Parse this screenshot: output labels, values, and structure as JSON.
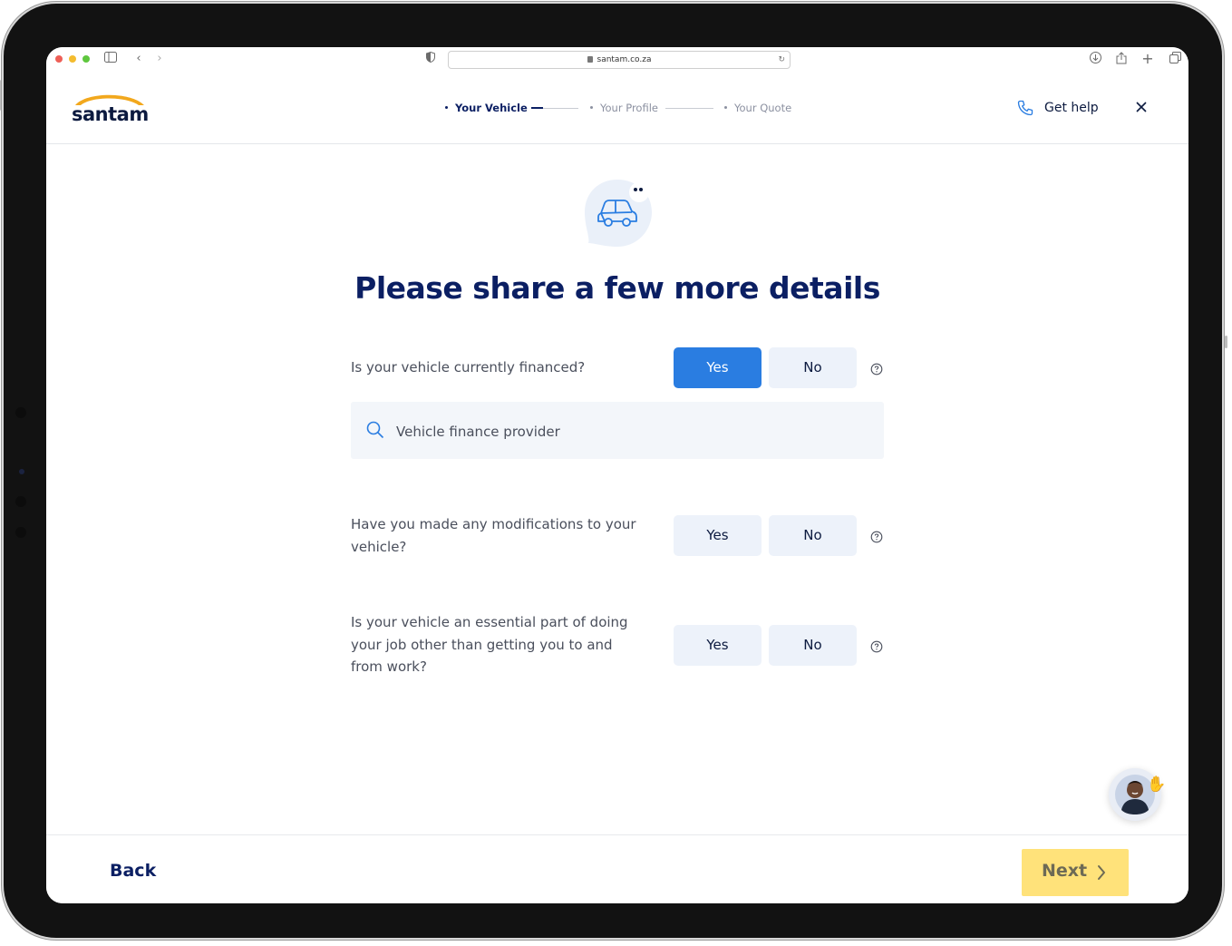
{
  "browser": {
    "url": "santam.co.za"
  },
  "brand": {
    "logo_text": "santam",
    "logo_color": "#0c1a3f",
    "accent_yellow": "#f2a81d"
  },
  "stepper": {
    "steps": [
      {
        "label": "Your Vehicle",
        "state": "active"
      },
      {
        "label": "Your Profile",
        "state": "upcoming"
      },
      {
        "label": "Your Quote",
        "state": "upcoming"
      }
    ]
  },
  "header": {
    "help_label": "Get help",
    "help_icon": "phone-icon",
    "close_icon": "close-icon"
  },
  "main": {
    "hero_icon": "car-chat-icon",
    "title": "Please share a few more details",
    "questions": [
      {
        "text": "Is your vehicle currently financed?",
        "yes": "Yes",
        "no": "No",
        "selected": "yes"
      },
      {
        "text": "Have you made any modifications to your vehicle?",
        "yes": "Yes",
        "no": "No",
        "selected": null
      },
      {
        "text": "Is your vehicle an essential part of doing your job other than getting you to and from work?",
        "yes": "Yes",
        "no": "No",
        "selected": null
      }
    ],
    "finance_search": {
      "placeholder": "Vehicle finance provider",
      "icon": "search-icon"
    },
    "chat_icon": "chat-assistant-avatar"
  },
  "footer": {
    "back_label": "Back",
    "next_label": "Next"
  },
  "colors": {
    "primary_blue": "#2a7de1",
    "navy": "#0b1f63",
    "button_bg": "#edf2fa",
    "next_bg": "#ffe27a"
  }
}
